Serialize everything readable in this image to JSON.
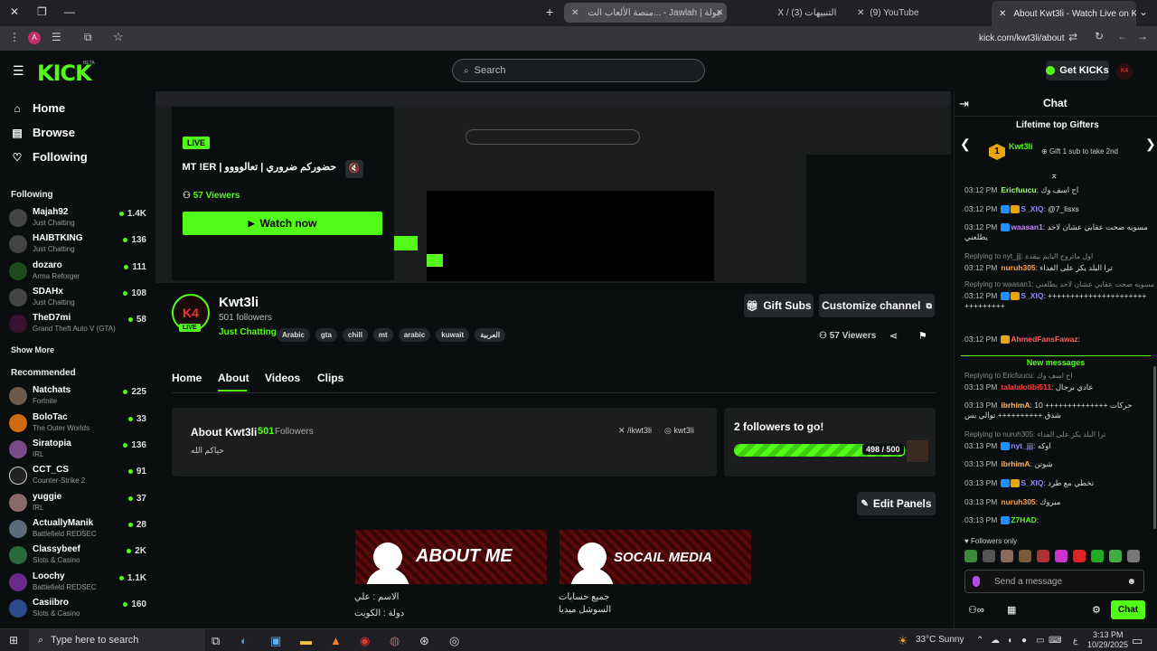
{
  "browser": {
    "tabs": [
      {
        "label": "منصة الألعاب الت... - Jawlah | جولة"
      },
      {
        "label": "X / (3) التنبيهات"
      },
      {
        "label": "(9) YouTube"
      },
      {
        "label": "About Kwt3li - Watch Live on K"
      }
    ],
    "url": "kick.com/kwt3li/about"
  },
  "header": {
    "logo": "KICK",
    "beta": "BETA",
    "search_placeholder": "Search",
    "get_kicks": "Get KICKs"
  },
  "sidebar": {
    "nav": [
      {
        "label": "Home"
      },
      {
        "label": "Browse"
      },
      {
        "label": "Following"
      }
    ],
    "following_title": "Following",
    "following": [
      {
        "name": "Majah92",
        "category": "Just Chatting",
        "viewers": "1.4K"
      },
      {
        "name": "HAIBTKING",
        "category": "Just Chatting",
        "viewers": "136"
      },
      {
        "name": "dozaro",
        "category": "Arma Reforger",
        "viewers": "111"
      },
      {
        "name": "SDAHx",
        "category": "Just Chatting",
        "viewers": "108"
      },
      {
        "name": "TheD7mi",
        "category": "Grand Theft Auto V (GTA)",
        "viewers": "58"
      }
    ],
    "show_more": "Show More",
    "recommended_title": "Recommended",
    "recommended": [
      {
        "name": "Natchats",
        "category": "Fortnite",
        "viewers": "225"
      },
      {
        "name": "BoloTac",
        "category": "The Outer Worlds",
        "viewers": "33"
      },
      {
        "name": "Siratopia",
        "category": "IRL",
        "viewers": "136"
      },
      {
        "name": "CCT_CS",
        "category": "Counter-Strike 2",
        "viewers": "91"
      },
      {
        "name": "yuggie",
        "category": "IRL",
        "viewers": "37"
      },
      {
        "name": "ActuallyManik",
        "category": "Battlefield REDSEC",
        "viewers": "28"
      },
      {
        "name": "Classybeef",
        "category": "Slots & Casino",
        "viewers": "2K"
      },
      {
        "name": "Loochy",
        "category": "Battlefield REDSEC",
        "viewers": "1.1K"
      },
      {
        "name": "Casiibro",
        "category": "Slots & Casino",
        "viewers": "160"
      }
    ]
  },
  "livecard": {
    "live": "LIVE",
    "title": "حضوركم ضروري | تعالوووو | MT !ER!",
    "viewers": "57 Viewers",
    "watch": "Watch now"
  },
  "channel": {
    "name": "Kwt3li",
    "followers": "501 followers",
    "category": "Just Chatting",
    "live_badge": "LIVE",
    "tags": [
      "Arabic",
      "gta",
      "chill",
      "mt",
      "arabic",
      "kuwait",
      "العربية"
    ],
    "gift_subs": "Gift Subs",
    "customize": "Customize channel",
    "viewers": "57 Viewers",
    "tabs": [
      "Home",
      "About",
      "Videos",
      "Clips"
    ]
  },
  "about": {
    "title": "About Kwt3li",
    "followers_count": "501",
    "followers_label": "Followers",
    "x_handle": "/ikwt3li",
    "ig_handle": "kwt3li",
    "bio": "حياكم الله",
    "goal_title": "2 followers to go!",
    "goal_progress": "498 / 500",
    "goal_fraction": 0.996,
    "edit_panels": "Edit Panels",
    "panel1": "ABOUT ME",
    "panel2": "SOCAIL MEDIA",
    "panel1_lines": [
      "الاسم : علي",
      "دولة : الكويت"
    ],
    "panel2_lines": [
      "جميع حسابات",
      "السوشل ميديا"
    ]
  },
  "chat": {
    "title": "Chat",
    "gifters_title": "Lifetime top Gifters",
    "top_gifter": "Kwt3li",
    "top_rank": "1",
    "gift_hint": "Gift 1 sub to take 2nd",
    "messages": [
      {
        "time": "03:12 PM",
        "user": "Ericfuucu",
        "text": "اح اسف وك",
        "color": "#9dff6b"
      },
      {
        "time": "03:12 PM",
        "user": "S_XIQ",
        "text": "@7_lisxs",
        "color": "#8a8aff"
      },
      {
        "time": "03:12 PM",
        "user": "waasan1",
        "text": "مسويه صحت عقابي عشان لاحد يطلعني",
        "color": "#c58aff"
      },
      {
        "time": "03:12 PM",
        "user": "nuruh305",
        "text": "ترا البلد يكز على الفداء",
        "color": "#ff9f45",
        "reply": "Replying to nyt_jjj: اول ماتروح البايم بيقدة"
      },
      {
        "time": "03:12 PM",
        "user": "S_XIQ",
        "text": "+++++++++++++++++++++++++++++++",
        "color": "#8a8aff",
        "reply": "Replying to waasan1: مسويه صحت عقابي عشان لاحد يطلعني"
      },
      {
        "time": "03:12 PM",
        "user": "AhmedFansFawaz",
        "text": "",
        "color": "#ff5f5f"
      }
    ],
    "new_messages": "New messages",
    "messages2": [
      {
        "time": "03:13 PM",
        "user": "talalalotibi511",
        "text": "عادي برجال",
        "color": "#ff4040",
        "reply": "Replying to Ericfuucu: اح اسف وك"
      },
      {
        "time": "03:13 PM",
        "user": "ibrhimA",
        "text": "10 ++++++++++++++ حركات شذق ++++++++++ توالي بس",
        "color": "#ffb86b"
      },
      {
        "time": "03:13 PM",
        "user": "nyt_jjj",
        "text": "اوكه",
        "color": "#8a8aff",
        "reply": "Replying to nuruh305: ترا البلد يكز على الفداء"
      },
      {
        "time": "03:13 PM",
        "user": "ibrhimA",
        "text": "شوتن",
        "color": "#ffb86b"
      },
      {
        "time": "03:13 PM",
        "user": "S_XIQ",
        "text": "تخطي مع طرد",
        "color": "#8a8aff"
      },
      {
        "time": "03:13 PM",
        "user": "nuruh305",
        "text": "مبروك",
        "color": "#ff9f45"
      },
      {
        "time": "03:13 PM",
        "user": "Z7HAD",
        "text": "",
        "color": "#53fc18"
      }
    ],
    "followers_only": "Followers only",
    "input_placeholder": "Send a message",
    "send": "Chat"
  },
  "taskbar": {
    "search": "Type here to search",
    "weather": "33°C  Sunny",
    "time": "3:13 PM",
    "date": "10/29/2025",
    "lang": "ع"
  },
  "colors": {
    "accent": "#53fc18",
    "bg": "#0b0e0f",
    "panel": "#1b1d1f"
  }
}
